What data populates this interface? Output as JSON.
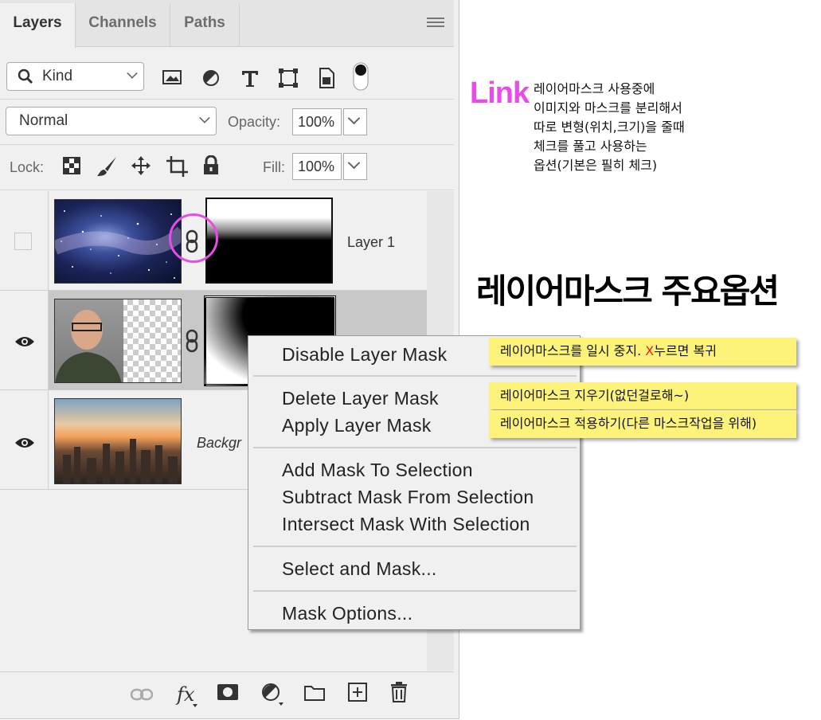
{
  "tabs": [
    {
      "label": "Layers",
      "active": true
    },
    {
      "label": "Channels",
      "active": false
    },
    {
      "label": "Paths",
      "active": false
    }
  ],
  "filter": {
    "kind_label": "Kind"
  },
  "blend": {
    "mode": "Normal",
    "opacity_label": "Opacity:",
    "opacity_value": "100%"
  },
  "lock": {
    "label": "Lock:",
    "fill_label": "Fill:",
    "fill_value": "100%"
  },
  "layers": [
    {
      "name": "Layer 1",
      "visible": false
    },
    {
      "name": "",
      "visible": true
    },
    {
      "name": "Backgr",
      "visible": true
    }
  ],
  "context_menu": {
    "disable": "Disable Layer Mask",
    "delete": "Delete Layer Mask",
    "apply": "Apply Layer Mask",
    "add_sel": "Add Mask To Selection",
    "sub_sel": "Subtract Mask From Selection",
    "int_sel": "Intersect Mask With Selection",
    "select_mask": "Select and Mask...",
    "options": "Mask Options..."
  },
  "notes": {
    "disable_prefix": "레이어마스크를 일시 중지. ",
    "disable_x": "X",
    "disable_suffix": "누르면 복귀",
    "delete": "레이어마스크 지우기(없던걸로해~)",
    "apply": "레이어마스크 적용하기(다른 마스크작업을 위해)"
  },
  "annotation": {
    "link_title": "Link",
    "link_lines": [
      "레이어마스크 사용중에",
      "이미지와 마스크를 분리해서",
      "따로 변형(위치,크기)을 줄때",
      "체크를 풀고 사용하는",
      "옵션(기본은 필히 체크)"
    ],
    "headline": "레이어마스크 주요옵션"
  },
  "colors": {
    "accent_magenta": "#e94be9",
    "note_yellow": "#fdf37b",
    "note_red_x": "#e8241c"
  }
}
